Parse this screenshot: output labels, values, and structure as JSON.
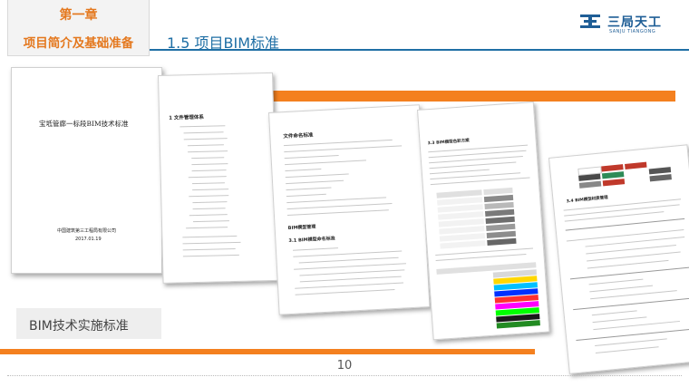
{
  "header": {
    "chapter_number": "第一章",
    "chapter_title": "项目简介及基础准备",
    "section_title": "1.5 项目BIM标准"
  },
  "logo": {
    "name_cn": "三局天工",
    "name_en": "SANJU TIANGONG"
  },
  "doc_cover": {
    "title": "宝坻管廊一标段BIM技术标准",
    "company": "中国建筑第三工程局有限公司",
    "date": "2017.01.19"
  },
  "doc_toc": {
    "heading": "1 文件管理体系"
  },
  "doc_naming": {
    "heading": "文件命名标准",
    "model_heading": "BIM模型管理",
    "sub_heading": "3.1 BIM模型命名标准"
  },
  "doc_color": {
    "heading": "3.3 BIM模型色彩方案"
  },
  "doc_material": {
    "heading": "3.4 BIM模型材质管理"
  },
  "caption": "BIM技术实施标准",
  "page_number": "10",
  "colors": {
    "accent_orange": "#f4801f",
    "chapter_orange": "#e4781e",
    "brand_blue": "#1f6fa5"
  }
}
